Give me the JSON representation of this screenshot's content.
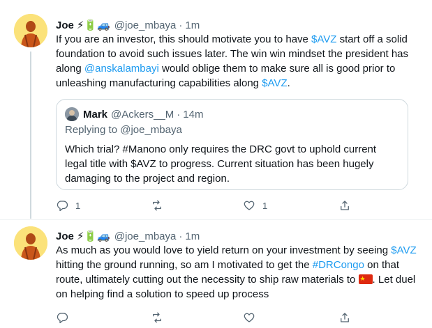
{
  "tweets": [
    {
      "name": "Joe",
      "emoji": "⚡🔋🚙",
      "handle": "@joe_mbaya",
      "separator": "·",
      "time": "1m",
      "body": {
        "p1": "If you are an investor, this should motivate you to have ",
        "l1": "$AVZ",
        "p2": " start off a solid foundation to avoid such issues later. The win win mindset the president has along ",
        "l2": "@anskalambayi",
        "p3": " would oblige them to make sure all is good prior to unleashing manufacturing capabilities along ",
        "l3": "$AVZ",
        "p4": "."
      },
      "quote": {
        "name": "Mark",
        "handle": "@Ackers__M",
        "separator": "·",
        "time": "14m",
        "replying": "Replying to @joe_mbaya",
        "text": "Which trial? #Manono only requires the DRC govt to uphold current legal title with $AVZ to progress. Current situation has been hugely damaging to the project and region."
      },
      "actions": {
        "reply_count": "1",
        "retweet_count": "",
        "like_count": "1"
      }
    },
    {
      "name": "Joe",
      "emoji": "⚡🔋🚙",
      "handle": "@joe_mbaya",
      "separator": "·",
      "time": "1m",
      "body": {
        "p1": "As much as you would love to yield return on your investment by seeing ",
        "l1": "$AVZ",
        "p2": " hitting the ground running, so am I motivated to get the ",
        "l2": "#DRCongo",
        "p3": " on that route, ultimately cutting out the necessity to ship raw materials to ",
        "p4": ". Let duel on helping find a solution to speed up process"
      },
      "flag_icon": "china-flag-icon",
      "actions": {
        "reply_count": "",
        "retweet_count": "",
        "like_count": ""
      }
    }
  ],
  "colors": {
    "link": "#1d9bf0",
    "muted": "#536471",
    "border": "#cfd9de",
    "text": "#0f1419"
  }
}
